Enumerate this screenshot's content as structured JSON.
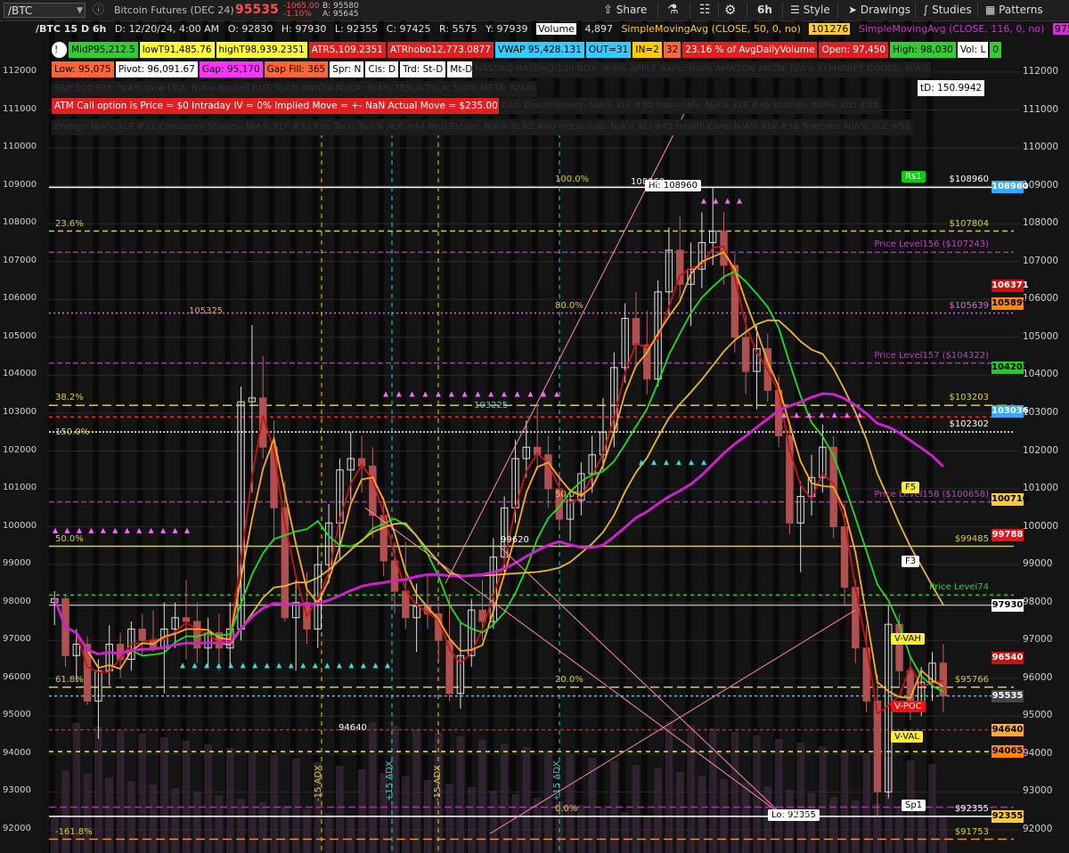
{
  "toolbar": {
    "symbol": "/BTC",
    "description": "Bitcoin Futures (DEC 24)",
    "last_price": "95535",
    "change": "-1065.00",
    "change_pct": "-1.10%",
    "bid": "B: 95580",
    "ask": "A: 95645",
    "share_label": "Share",
    "interval_label": "6h",
    "style_label": "Style",
    "drawings_label": "Drawings",
    "studies_label": "Studies",
    "patterns_label": "Patterns"
  },
  "header": {
    "ticker": "/BTC 15 D 6h",
    "date": "D: 12/20/24, 4:00 AM",
    "open": "O: 92830",
    "high": "H: 97930",
    "low": "L: 92355",
    "close": "C: 97425",
    "range": "R: 5575",
    "y": "Y: 97939",
    "volume_label": "Volume",
    "volume": "4,897",
    "sma50_label": "SimpleMovingAvg (CLOSE, 50, 0, no)",
    "sma50_value": "101276",
    "sma116_label": "SimpleMovingAvg (CLOSE, 116, 0, no)",
    "sma116_value": "97567"
  },
  "labels_row1": [
    {
      "text": "MidP95,212.5",
      "bg": "#33cc33",
      "fg": "#000"
    },
    {
      "text": "lowT91,485.76",
      "bg": "#ffff33",
      "fg": "#000"
    },
    {
      "text": "highT98,939.2351",
      "bg": "#ffff33",
      "fg": "#000"
    },
    {
      "text": "ATR5,109.2351",
      "bg": "#e02020",
      "fg": "#fff"
    },
    {
      "text": "ATRhobo12,773.0877",
      "bg": "#e02020",
      "fg": "#fff"
    },
    {
      "text": "VWAP 95,428.131",
      "bg": "#33ccff",
      "fg": "#000"
    },
    {
      "text": "OUT=31",
      "bg": "#33ccff",
      "fg": "#000"
    },
    {
      "text": "IN=2",
      "bg": "#ffcc00",
      "fg": "#000"
    },
    {
      "text": "32",
      "bg": "#ff6633",
      "fg": "#000"
    },
    {
      "text": "23.16 % of AvgDailyVolume",
      "bg": "#e02020",
      "fg": "#fff"
    },
    {
      "text": "Open: 97,450",
      "bg": "#e02020",
      "fg": "#fff"
    },
    {
      "text": "High: 98,030",
      "bg": "#33cc33",
      "fg": "#000"
    },
    {
      "text": "Vol: L",
      "bg": "#ffffff",
      "fg": "#000"
    },
    {
      "text": "0",
      "bg": "#33cc33",
      "fg": "#000"
    }
  ],
  "labels_row2": [
    {
      "text": "Low: 95,075",
      "bg": "#ff6633",
      "fg": "#000"
    },
    {
      "text": "Pivot: 96,091.67",
      "bg": "#ffffff",
      "fg": "#000"
    },
    {
      "text": "Gap: 95,170",
      "bg": "#ff33ff",
      "fg": "#000"
    },
    {
      "text": "Gap Fill: 365",
      "bg": "#ff6633",
      "fg": "#000"
    },
    {
      "text": "Spr: N",
      "bg": "#ffffff",
      "fg": "#000"
    },
    {
      "text": "Cls: D",
      "bg": "#ffffff",
      "fg": "#000"
    },
    {
      "text": "Trd: St-D",
      "bg": "#ffffff",
      "fg": "#000"
    },
    {
      "text": "Mt-D",
      "bg": "#ffffff",
      "fg": "#000"
    },
    {
      "text": "Lt-D",
      "bg": "#ffffff",
      "fg": "#000"
    },
    {
      "text": "V > 390",
      "bg": "#cccccc",
      "fg": "#000"
    },
    {
      "text": "0",
      "bg": "#e02020",
      "fg": "#fff"
    }
  ],
  "labels_row2_dim": "NASDAQ NASDAQ-100 NDX: N/A%   APPLE AAPL: N/A%   AMAZON AMZN: N/A%   ALPHABET GOOGL: N/A%",
  "labels_row3_dim": "S&P 500 SPX: N/A%   Dow DJIA: N/A%   Russell RUT: N/A%   NVIDIA NVDA: N/A%   TESLA TSLA: N/A%   META: N/A%",
  "td_label": "tD: 150.9942",
  "atm_label": "ATM Call option is  Price = $0  Intraday IV = 0%  Implied Move = +- NaN  Actual Move = $235.00",
  "sector_row4_dim": "Con. Discretionary: N/A% XLY #35   Financials: N/A% XLF #46   Utilities: N/A% XLU #55",
  "sector_row5_dim": "Energy: N/A% XLE #31   Consumer Staples: N/A% XLP #32   Info Tech: N/A% XLK #44   Real Estate: N/A% XLRE #60   Industrials: N/A% XLI #42   Health Care: N/A% XLV #38   Telecom: N/A% XLC #56",
  "price_axis": [
    "112000",
    "111000",
    "110000",
    "109000",
    "108000",
    "107000",
    "106000",
    "105000",
    "104000",
    "103000",
    "102000",
    "101000",
    "100000",
    "99000",
    "98000",
    "97000",
    "96000",
    "95000",
    "94000",
    "93000",
    "92000"
  ],
  "price_tags": [
    {
      "text": "108960",
      "price": 108960,
      "bg": "#33aaff",
      "fg": "#fff"
    },
    {
      "text": "106371",
      "price": 106371,
      "bg": "#cc1111",
      "fg": "#fff"
    },
    {
      "text": "105899",
      "price": 105899,
      "bg": "#ff8800",
      "fg": "#000"
    },
    {
      "text": "104203",
      "price": 104203,
      "bg": "#22cc22",
      "fg": "#000"
    },
    {
      "text": "103036",
      "price": 103036,
      "bg": "#33aaff",
      "fg": "#fff"
    },
    {
      "text": "100710",
      "price": 100710,
      "bg": "#ffcc33",
      "fg": "#000"
    },
    {
      "text": "99788",
      "price": 99788,
      "bg": "#ee1111",
      "fg": "#fff"
    },
    {
      "text": "97930",
      "price": 97930,
      "bg": "#ffffff",
      "fg": "#000"
    },
    {
      "text": "96540",
      "price": 96540,
      "bg": "#cc1111",
      "fg": "#fff"
    },
    {
      "text": "95535",
      "price": 95535,
      "bg": "#444444",
      "fg": "#fff"
    },
    {
      "text": "94640",
      "price": 94640,
      "bg": "#ffaa33",
      "fg": "#000"
    },
    {
      "text": "94065",
      "price": 94065,
      "bg": "#ff8800",
      "fg": "#000"
    },
    {
      "text": "92355",
      "price": 92355,
      "bg": "#ffcc33",
      "fg": "#000"
    }
  ],
  "level_labels": [
    {
      "text": "$108960",
      "price": 108960,
      "color": "#ffffff"
    },
    {
      "text": "$107804",
      "price": 107804,
      "color": "#ddcc33"
    },
    {
      "text": "Price Level156 ($107243)",
      "price": 107243,
      "color": "#bb44bb"
    },
    {
      "text": "$105639",
      "price": 105639,
      "color": "#dd66dd"
    },
    {
      "text": "Price Level157 ($104322)",
      "price": 104322,
      "color": "#bb44bb"
    },
    {
      "text": "$103203",
      "price": 103203,
      "color": "#ddcc33"
    },
    {
      "text": "$102302",
      "price": 102502,
      "color": "#ffffff"
    },
    {
      "text": "Price Level158 ($100658)",
      "price": 100658,
      "color": "#bb44bb"
    },
    {
      "text": "$99485",
      "price": 99485,
      "color": "#ddcc33"
    },
    {
      "text": "Price Level74",
      "price": 98200,
      "color": "#33cc33"
    },
    {
      "text": "$95766",
      "price": 95766,
      "color": "#ddcc33"
    },
    {
      "text": "$92355",
      "price": 92355,
      "color": "#ffffff"
    },
    {
      "text": "$91753",
      "price": 91753,
      "color": "#ddcc33"
    }
  ],
  "fib_labels": [
    {
      "text": "100.0%",
      "price": 108960,
      "x": 623
    },
    {
      "text": "23.6%",
      "price": 107804,
      "x": 62
    },
    {
      "text": "80.0%",
      "price": 105639,
      "x": 623
    },
    {
      "text": "38.2%",
      "price": 103203,
      "x": 62
    },
    {
      "text": "150.0%",
      "price": 102302,
      "x": 62
    },
    {
      "text": "50.0%",
      "price": 100658,
      "x": 623
    },
    {
      "text": "50.0%",
      "price": 99485,
      "x": 62
    },
    {
      "text": "61.8%",
      "price": 95766,
      "x": 62
    },
    {
      "text": "20.0%",
      "price": 95766,
      "x": 623
    },
    {
      "text": "0.0%",
      "price": 92355,
      "x": 623
    },
    {
      "text": "-161.8%",
      "price": 91753,
      "x": 62
    }
  ],
  "callouts": [
    {
      "text": "Hi: 108960",
      "price": 108960
    },
    {
      "text": "Lo: 92355",
      "price": 92355
    },
    {
      "text": "Rs1",
      "price": 109200
    },
    {
      "text": "F5",
      "price": 101000
    },
    {
      "text": "F3",
      "price": 99050
    },
    {
      "text": "V-VAH",
      "price": 97000
    },
    {
      "text": "V-POC",
      "price": 95230
    },
    {
      "text": "V-VAL",
      "price": 94420
    },
    {
      "text": "Sp1",
      "price": 92600
    }
  ],
  "annotations": {
    "peak_105325": "105325",
    "low_94640": "94640",
    "mid_103225": "103225",
    "mid_99620": "99620",
    "peak_108960": "108960",
    "low_92355": "92355",
    "adx_labels": [
      "-15 ADX",
      "+15 ADX",
      "-15 ADX",
      "+15 ADX"
    ]
  },
  "chart_data": {
    "type": "candlestick",
    "interval": "6h",
    "ylim": [
      91700,
      112500
    ],
    "candles": [
      [
        98000,
        98300,
        97400,
        98100
      ],
      [
        98100,
        98200,
        96300,
        96600
      ],
      [
        96600,
        97300,
        95900,
        96900
      ],
      [
        96900,
        97100,
        95300,
        95400
      ],
      [
        95400,
        96500,
        94400,
        96200
      ],
      [
        96200,
        97400,
        95800,
        96900
      ],
      [
        96900,
        97200,
        96000,
        96500
      ],
      [
        96500,
        97500,
        96200,
        97300
      ],
      [
        97300,
        97700,
        96600,
        97000
      ],
      [
        97000,
        97800,
        96700,
        96800
      ],
      [
        96800,
        98000,
        95600,
        97300
      ],
      [
        97300,
        98000,
        96800,
        97600
      ],
      [
        97600,
        98600,
        96500,
        97500
      ],
      [
        97500,
        98000,
        96400,
        96800
      ],
      [
        96800,
        97600,
        96300,
        97200
      ],
      [
        97200,
        97700,
        96200,
        96800
      ],
      [
        96800,
        98000,
        96300,
        97300
      ],
      [
        97300,
        103700,
        97000,
        103300
      ],
      [
        103300,
        105325,
        100900,
        103400
      ],
      [
        103400,
        104500,
        101800,
        102100
      ],
      [
        102100,
        102800,
        99600,
        100500
      ],
      [
        100500,
        101200,
        97500,
        97600
      ],
      [
        97600,
        98600,
        96200,
        98000
      ],
      [
        98000,
        98800,
        96900,
        97300
      ],
      [
        97300,
        99500,
        96800,
        99000
      ],
      [
        99000,
        100600,
        98500,
        100100
      ],
      [
        100100,
        101800,
        99100,
        101500
      ],
      [
        101500,
        102500,
        100700,
        101800
      ],
      [
        101800,
        102400,
        100900,
        101600
      ],
      [
        101600,
        102100,
        99700,
        100300
      ],
      [
        100300,
        100800,
        98700,
        99100
      ],
      [
        99100,
        99600,
        97700,
        98300
      ],
      [
        98300,
        99600,
        97300,
        97600
      ],
      [
        97600,
        98500,
        96700,
        97900
      ],
      [
        97900,
        98700,
        97300,
        97700
      ],
      [
        97700,
        98000,
        96500,
        97000
      ],
      [
        97000,
        98200,
        95400,
        95600
      ],
      [
        95600,
        97500,
        95200,
        96600
      ],
      [
        96600,
        98100,
        96300,
        97800
      ],
      [
        97800,
        98600,
        97000,
        97500
      ],
      [
        97500,
        99700,
        97300,
        99200
      ],
      [
        99200,
        100800,
        98800,
        100500
      ],
      [
        100500,
        102300,
        100100,
        101800
      ],
      [
        101800,
        102800,
        101300,
        102100
      ],
      [
        102100,
        103225,
        101500,
        101900
      ],
      [
        101900,
        102400,
        100500,
        101000
      ],
      [
        101000,
        101400,
        99900,
        100200
      ],
      [
        100200,
        101000,
        99620,
        100700
      ],
      [
        100700,
        101700,
        100300,
        101400
      ],
      [
        101400,
        102400,
        100900,
        101900
      ],
      [
        101900,
        103400,
        101500,
        102500
      ],
      [
        102500,
        104600,
        102100,
        104200
      ],
      [
        104200,
        105900,
        103800,
        105500
      ],
      [
        105500,
        106200,
        104300,
        104800
      ],
      [
        104800,
        105700,
        103500,
        103900
      ],
      [
        103900,
        106500,
        103700,
        106200
      ],
      [
        106200,
        107900,
        105600,
        107300
      ],
      [
        107300,
        108200,
        106000,
        106400
      ],
      [
        106400,
        107500,
        105300,
        106800
      ],
      [
        106800,
        108300,
        106300,
        107500
      ],
      [
        107500,
        108960,
        106900,
        107800
      ],
      [
        107800,
        108300,
        106400,
        106900
      ],
      [
        106900,
        107200,
        104600,
        105000
      ],
      [
        105000,
        105600,
        103500,
        104100
      ],
      [
        104100,
        105300,
        103100,
        104700
      ],
      [
        104700,
        105100,
        103300,
        103600
      ],
      [
        103600,
        104000,
        102100,
        102400
      ],
      [
        102400,
        102800,
        99800,
        100100
      ],
      [
        100100,
        101200,
        98800,
        100800
      ],
      [
        100800,
        101900,
        100300,
        101300
      ],
      [
        101300,
        102700,
        100900,
        102100
      ],
      [
        102100,
        102400,
        99700,
        100000
      ],
      [
        100000,
        100600,
        97900,
        98400
      ],
      [
        98400,
        98600,
        96400,
        96800
      ],
      [
        96800,
        97400,
        95100,
        95400
      ],
      [
        95400,
        96100,
        92355,
        93000
      ],
      [
        93000,
        97930,
        92830,
        97425
      ],
      [
        97425,
        97700,
        95800,
        96200
      ],
      [
        96200,
        96600,
        94900,
        95300
      ],
      [
        95300,
        96300,
        95000,
        95900
      ],
      [
        95900,
        96700,
        95400,
        96400
      ],
      [
        96400,
        96900,
        95100,
        95535
      ]
    ]
  }
}
